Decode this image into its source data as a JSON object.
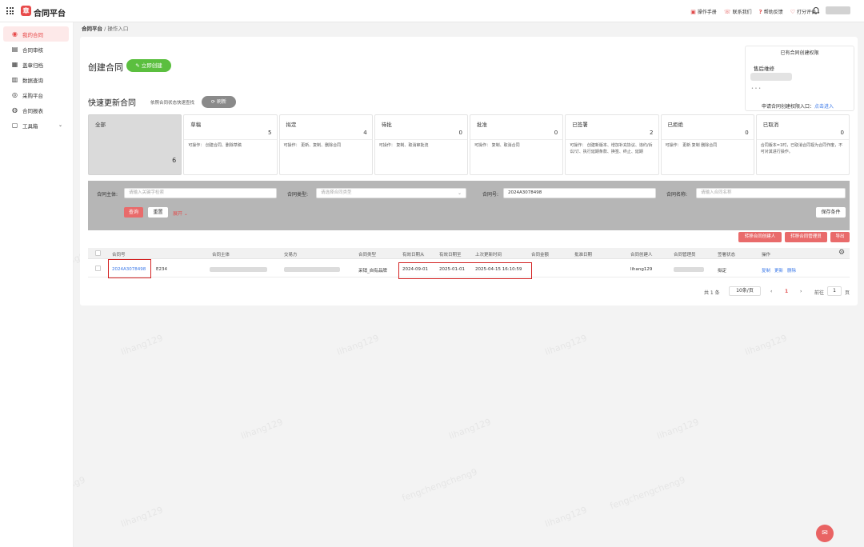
{
  "app": {
    "title": "合同平台",
    "logo_glyph": "章"
  },
  "topbar": {
    "links": [
      {
        "icon": "manual-icon",
        "glyph": "▣",
        "label": "操作手册"
      },
      {
        "icon": "contact-icon",
        "glyph": "☏",
        "label": "联系我们"
      },
      {
        "icon": "help-icon",
        "glyph": "?",
        "label": "帮助反馈"
      },
      {
        "icon": "rate-icon",
        "glyph": "♡",
        "label": "打分评价"
      }
    ],
    "bell": "♪"
  },
  "sidebar": {
    "items": [
      {
        "label": "我的合同",
        "icon": "user-circle-icon",
        "glyph": "◉",
        "active": true
      },
      {
        "label": "合同审核",
        "icon": "document-icon",
        "glyph": "▤"
      },
      {
        "label": "盖章归档",
        "icon": "stamp-icon",
        "glyph": "▦"
      },
      {
        "label": "数据查询",
        "icon": "data-icon",
        "glyph": "▥"
      },
      {
        "label": "采购平台",
        "icon": "cart-icon",
        "glyph": "◎"
      },
      {
        "label": "合同报表",
        "icon": "report-icon",
        "glyph": "◍"
      },
      {
        "label": "工具箱",
        "icon": "toolbox-icon",
        "glyph": "▢",
        "chevron": "⌄"
      }
    ]
  },
  "breadcrumb": {
    "root": "合同平台",
    "sep": " / ",
    "current": "操作入口"
  },
  "create": {
    "title": "创建合同",
    "button": "✎ 立即创建"
  },
  "quick": {
    "title": "快速更新合同",
    "hint": "依照合同状态快速查找",
    "refresh": "⟳ 刷新"
  },
  "permission": {
    "title": "已有合同创建权限",
    "name": "售后维修",
    "dot": "• • •",
    "apply_label": "申请合同创建权限入口：",
    "apply_link": "点击进入"
  },
  "status_cards": [
    {
      "title": "全部",
      "count": "6",
      "desc": ""
    },
    {
      "title": "草稿",
      "count": "5",
      "desc": "可操作：  创建合同、删除草稿"
    },
    {
      "title": "拟定",
      "count": "4",
      "desc": "可操作：  更新、复制、删除合同"
    },
    {
      "title": "待批",
      "count": "0",
      "desc": "可操作：  复制、取消审批流"
    },
    {
      "title": "批准",
      "count": "0",
      "desc": "可操作：  复制、取消合同"
    },
    {
      "title": "已签署",
      "count": "2",
      "desc": "可操作：  创建新版本、增加补充协议、违约/诉讼/订、执行延期条款、换签、终止、延期"
    },
    {
      "title": "已拒绝",
      "count": "0",
      "desc": "可操作：  更新 复制 删除合同"
    },
    {
      "title": "已取消",
      "count": "0",
      "desc": "合同版本=1时，已取消合同视为合同作废，不可对其进行操作。"
    }
  ],
  "filter": {
    "subject_label": "合同主体:",
    "subject_placeholder": "请输入关键字检索",
    "type_label": "合同类型:",
    "type_placeholder": "请选择合同类型",
    "no_label": "合同号:",
    "no_value": "2024A3078498",
    "name_label": "合同名称:",
    "name_placeholder": "请输入合同名称",
    "query": "查询",
    "reset": "重置",
    "expand": "展开 ⌄",
    "save": "保存条件"
  },
  "actions": {
    "transfer_creator": "转移合同创建人",
    "transfer_manager": "转移合同管理员",
    "export": "导出"
  },
  "table": {
    "headers": [
      "合同号",
      "合同主体",
      "交易方",
      "合同类型",
      "有效日期从",
      "有效日期至",
      "上次更新时间",
      "合同金额",
      "批准日期",
      "合同创建人",
      "合同管理员",
      "签署状态",
      "操作"
    ],
    "rows": [
      {
        "no": "2024A3078498",
        "subject_suffix": "E234",
        "type": "采销_自有品牌",
        "from": "2024-09-01",
        "to": "2025-01-01",
        "updated": "2025-04-15 16:10:59",
        "amount": "",
        "approved": "",
        "creator": "lihang129",
        "status": "拟定",
        "ops": [
          "复制",
          "更新",
          "删除"
        ]
      }
    ]
  },
  "pagination": {
    "total": "共 1 条",
    "size": "10条/页",
    "prev": "‹",
    "page": "1",
    "next": "›",
    "goto_label": "前往",
    "goto_value": "1",
    "page_suffix": "页"
  },
  "watermarks": [
    "lihang129",
    "fengchengcheng9"
  ]
}
